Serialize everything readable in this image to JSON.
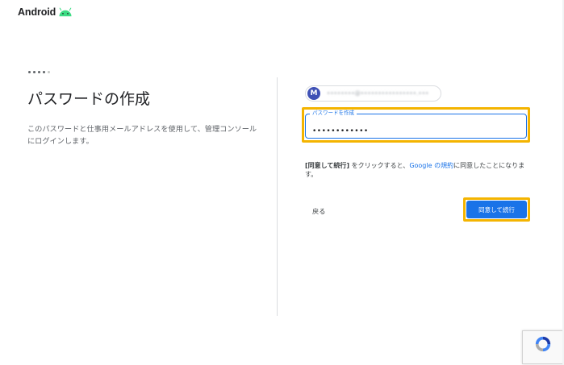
{
  "header": {
    "brand": "Android"
  },
  "steps": {
    "completed": 4,
    "total": 5
  },
  "left": {
    "title": "パスワードの作成",
    "description": "このパスワードと仕事用メールアドレスを使用して、管理コンソールにログインします。"
  },
  "account": {
    "avatar_letter": "M",
    "email_masked": "••••••••@••••••••••••••••.•••"
  },
  "password_field": {
    "label": "パスワードを作成",
    "value": "••••••••••••"
  },
  "consent": {
    "bold": "[同意して続行]",
    "pre": " をクリックすると、",
    "link": "Google の規約",
    "post": "に同意したことになります。"
  },
  "buttons": {
    "back": "戻る",
    "continue": "同意して続行"
  },
  "colors": {
    "accent": "#1a73e8",
    "highlight": "#f4b400",
    "avatar": "#3f51b5",
    "android_green": "#3ddc84"
  },
  "icons": {
    "brand": "android-robot-icon",
    "captcha": "recaptcha-icon"
  }
}
